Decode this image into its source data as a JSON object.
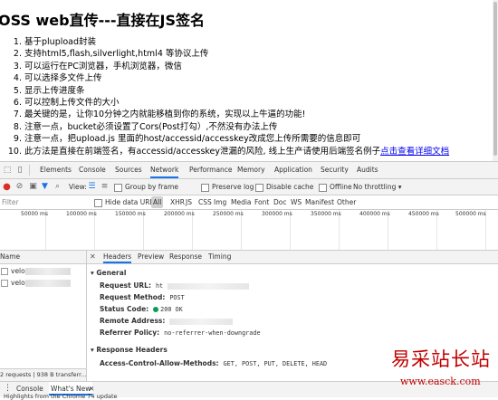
{
  "page": {
    "title": "OSS web直传---直接在JS签名",
    "items": [
      "基于plupload封装",
      "支持html5,flash,silverlight,html4 等协议上传",
      "可以运行在PC浏览器，手机浏览器，微信",
      "可以选择多文件上传",
      "显示上传进度条",
      "可以控制上传文件的大小",
      "最关键的是，让你10分钟之内就能移植到你的系统，实现以上牛逼的功能!",
      "注意一点，bucket必须设置了Cors(Post打勾）,不然没有办法上传",
      "注意一点，把upload.js 里面的host/accessid/accesskey改成您上传所需要的信息即可",
      "此方法是直接在前端签名，有accessid/accesskey泄漏的风险, 线上生产请使用后端签名例子"
    ],
    "link_text": "点击查看详细文档"
  },
  "devtools": {
    "tabs": [
      "Elements",
      "Console",
      "Sources",
      "Network",
      "Performance",
      "Memory",
      "Application",
      "Security",
      "Audits"
    ],
    "active_tab": "Network",
    "toolbar": {
      "view_label": "View:",
      "group_by_frame": "Group by frame",
      "preserve_log": "Preserve log",
      "disable_cache": "Disable cache",
      "offline": "Offline",
      "throttle": "No throttling"
    },
    "filter": {
      "placeholder": "Filter",
      "hide_data_urls": "Hide data URLs",
      "types": [
        "All",
        "XHR",
        "JS",
        "CSS",
        "Img",
        "Media",
        "Font",
        "Doc",
        "WS",
        "Manifest",
        "Other"
      ]
    },
    "timeline_ticks": [
      "50000 ms",
      "100000 ms",
      "150000 ms",
      "200000 ms",
      "250000 ms",
      "300000 ms",
      "350000 ms",
      "400000 ms",
      "450000 ms",
      "500000 ms"
    ],
    "requests": {
      "header": "Name",
      "rows": [
        "velo",
        "velo"
      ],
      "status": "2 requests | 938 B transferr..."
    },
    "detail": {
      "tabs": [
        "Headers",
        "Preview",
        "Response",
        "Timing"
      ],
      "active_tab": "Headers",
      "general_title": "General",
      "request_url_key": "Request URL:",
      "request_url_val": "ht",
      "request_method_key": "Request Method:",
      "request_method_val": "POST",
      "status_code_key": "Status Code:",
      "status_code_val": "200 OK",
      "remote_address_key": "Remote Address:",
      "referrer_policy_key": "Referrer Policy:",
      "referrer_policy_val": "no-referrer-when-downgrade",
      "response_headers_title": "Response Headers",
      "acam_key": "Access-Control-Allow-Methods:",
      "acam_val": "GET, POST, PUT, DELETE, HEAD"
    },
    "drawer": {
      "tabs": [
        "Console",
        "What's New"
      ],
      "active_tab": "What's New",
      "highlight": "Highlights from the Chrome 74 update"
    }
  },
  "watermark": {
    "title": "易采站长站",
    "url": "www.easck.com"
  }
}
